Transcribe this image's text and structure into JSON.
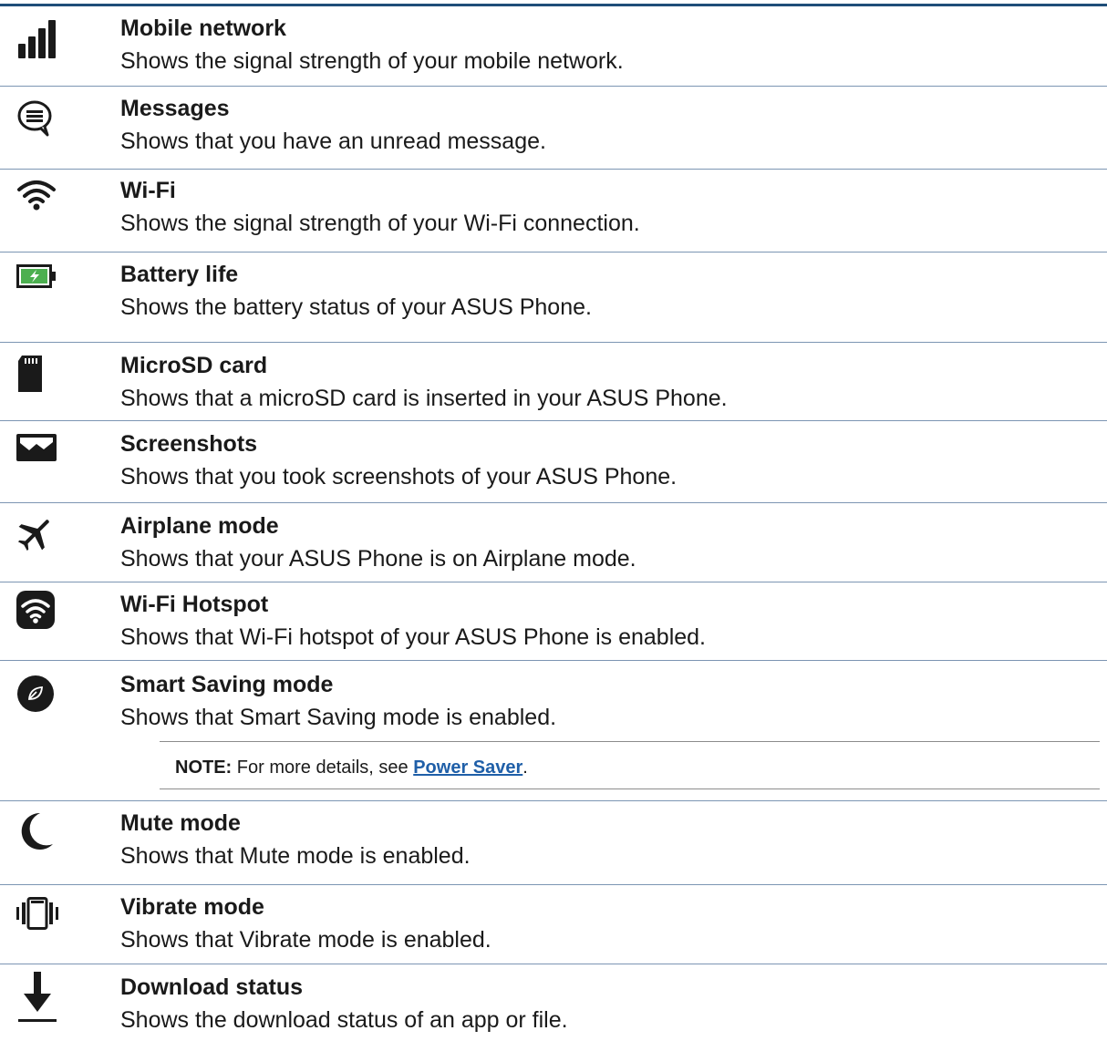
{
  "items": [
    {
      "icon": "signal-bars-icon",
      "title": "Mobile network",
      "description": "Shows the signal strength of your mobile network."
    },
    {
      "icon": "message-bubble-icon",
      "title": "Messages",
      "description": "Shows that you have an unread message."
    },
    {
      "icon": "wifi-icon",
      "title": "Wi-Fi",
      "description": "Shows the signal strength of your Wi-Fi connection."
    },
    {
      "icon": "battery-charging-icon",
      "title": "Battery life",
      "description": "Shows the battery status of your ASUS Phone."
    },
    {
      "icon": "microsd-card-icon",
      "title": "MicroSD card",
      "description": "Shows that a microSD card is inserted in your ASUS Phone."
    },
    {
      "icon": "screenshot-icon",
      "title": "Screenshots",
      "description": "Shows that you took screenshots of your ASUS Phone."
    },
    {
      "icon": "airplane-icon",
      "title": "Airplane mode",
      "description": "Shows that your ASUS Phone is on Airplane mode."
    },
    {
      "icon": "wifi-hotspot-icon",
      "title": "Wi-Fi Hotspot",
      "description": "Shows that Wi-Fi hotspot of your ASUS Phone is enabled."
    },
    {
      "icon": "smart-saving-leaf-icon",
      "title": "Smart Saving mode",
      "description": "Shows that Smart Saving mode is enabled."
    },
    {
      "icon": "moon-icon",
      "title": "Mute mode",
      "description": "Shows that Mute mode is enabled."
    },
    {
      "icon": "vibrate-icon",
      "title": "Vibrate mode",
      "description": "Shows that Vibrate mode is enabled."
    },
    {
      "icon": "download-arrow-icon",
      "title": "Download status",
      "description": "Shows the download status of an app or file."
    }
  ],
  "note": {
    "label": "NOTE:",
    "text_before": "For more details, see",
    "link_text": "Power Saver",
    "text_after": "."
  },
  "colors": {
    "rule": "#1f4e79",
    "separator": "#7c95b3",
    "link": "#1f5fa8",
    "battery_fill": "#4caf50"
  }
}
